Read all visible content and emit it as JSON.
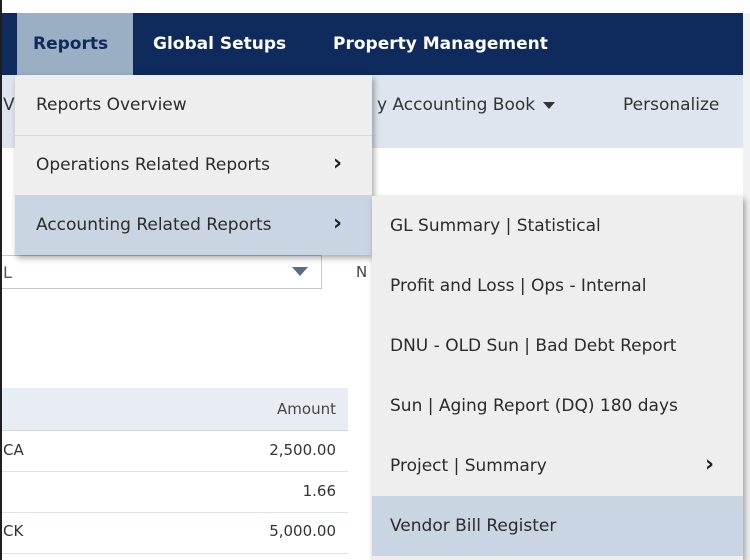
{
  "nav": {
    "items": [
      {
        "label": "Reports",
        "active": true
      },
      {
        "label": "Global Setups",
        "active": false
      },
      {
        "label": "Property Management",
        "active": false
      }
    ]
  },
  "subbar": {
    "accounting_book": "y Accounting Book",
    "personalize": "Personalize",
    "left_stub": "V"
  },
  "reports_menu": {
    "items": [
      {
        "label": "Reports Overview",
        "has_submenu": false,
        "selected": false
      },
      {
        "label": "Operations Related Reports",
        "has_submenu": true,
        "selected": false
      },
      {
        "label": "Accounting Related Reports",
        "has_submenu": true,
        "selected": true
      }
    ],
    "chevron": "›"
  },
  "accounting_submenu": {
    "items": [
      {
        "label": "GL Summary | Statistical",
        "has_submenu": false,
        "selected": false
      },
      {
        "label": "Profit and Loss | Ops - Internal",
        "has_submenu": false,
        "selected": false
      },
      {
        "label": "DNU - OLD Sun | Bad Debt Report",
        "has_submenu": false,
        "selected": false
      },
      {
        "label": "Sun | Aging Report (DQ) 180 days",
        "has_submenu": false,
        "selected": false
      },
      {
        "label": "Project | Summary",
        "has_submenu": true,
        "selected": false
      },
      {
        "label": "Vendor Bill Register",
        "has_submenu": false,
        "selected": true
      }
    ],
    "chevron": "›"
  },
  "filter": {
    "select_stub": "L",
    "n_stub": "N"
  },
  "table": {
    "header_amount": "Amount",
    "rows": [
      {
        "left": "CA",
        "amount": "2,500.00"
      },
      {
        "left": "",
        "amount": "1.66"
      },
      {
        "left": "CK",
        "amount": "5,000.00"
      }
    ]
  },
  "colors": {
    "navbar": "#0f2a5c",
    "nav_active": "#9aaec4",
    "menu_bg": "#eeeeee",
    "menu_selected": "#c9d5e2"
  }
}
